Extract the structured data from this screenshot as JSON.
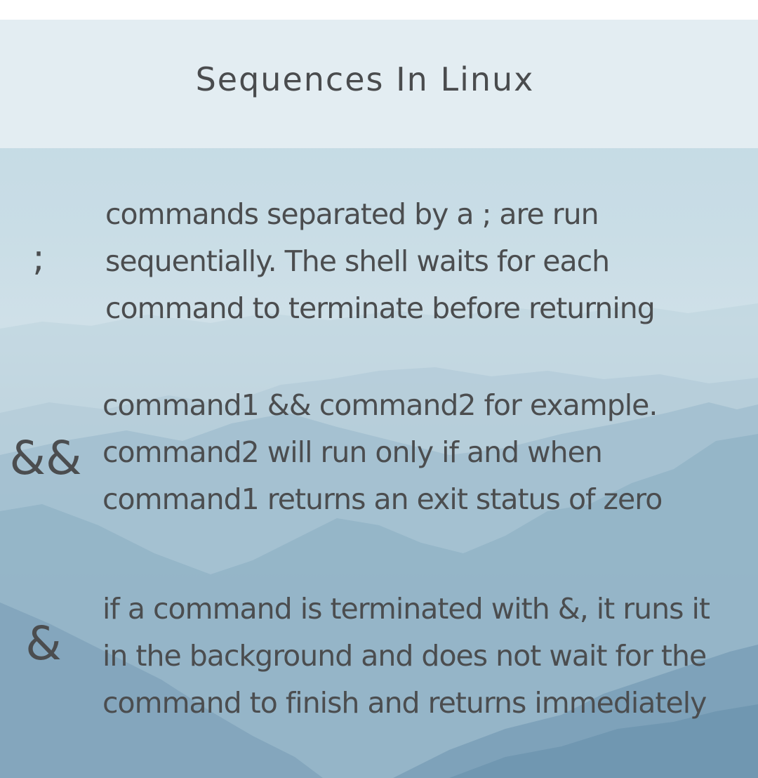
{
  "title": "Sequences In Linux",
  "sequences": [
    {
      "symbol": ";",
      "lines": [
        "commands separated by a ; are run",
        "sequentially. The shell waits for each",
        "command to terminate before returning"
      ]
    },
    {
      "symbol": "&&",
      "lines": [
        "command1 && command2 for example.",
        "command2 will run only if and when",
        "command1 returns an exit status of zero"
      ]
    },
    {
      "symbol": "&",
      "lines": [
        "if a command is terminated with &, it runs it",
        "in the background and does not wait for the",
        "command to finish and returns immediately"
      ]
    }
  ],
  "colors": {
    "header_band": "#e3edf2",
    "text": "#4b4d4f",
    "sky": "#c9dde6",
    "mountain": "#8fb0c4"
  }
}
